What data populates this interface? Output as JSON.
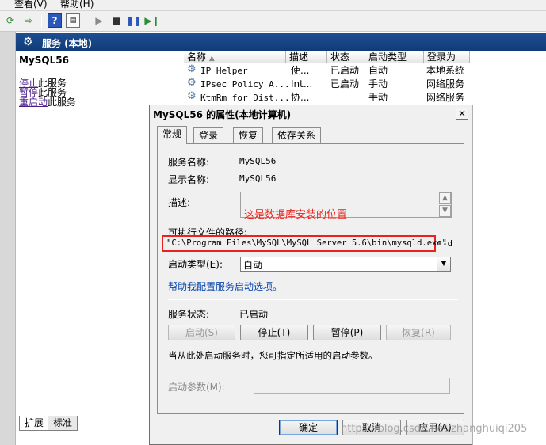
{
  "menubar": {
    "items": [
      "查看(V)",
      "帮助(H)"
    ]
  },
  "toolbar": {
    "icons": [
      "refresh-icon",
      "export-icon",
      "help-icon",
      "properties-icon",
      "play-icon",
      "stop-icon",
      "pause-icon",
      "restart-icon"
    ]
  },
  "pane": {
    "title": "服务 (本地)"
  },
  "left_panel": {
    "service_name": "MySQL56",
    "actions": [
      {
        "link": "停止",
        "rest": "此服务"
      },
      {
        "link": "暂停",
        "rest": "此服务"
      },
      {
        "link": "重启动",
        "rest": "此服务"
      }
    ]
  },
  "list": {
    "columns": [
      "名称",
      "描述",
      "状态",
      "启动类型",
      "登录为"
    ],
    "rows": [
      {
        "name": "IP Helper",
        "desc": "使...",
        "status": "已启动",
        "startup": "自动",
        "logon": "本地系统"
      },
      {
        "name": "IPsec Policy A...",
        "desc": "Int...",
        "status": "已启动",
        "startup": "手动",
        "logon": "网络服务"
      },
      {
        "name": "KtmRm for Dist...",
        "desc": "协...",
        "status": "",
        "startup": "手动",
        "logon": "网络服务"
      }
    ]
  },
  "bottom_tabs": {
    "extended": "扩展",
    "standard": "标准"
  },
  "dialog": {
    "title": "MySQL56 的属性(本地计算机)",
    "close": "×",
    "tabs": [
      "常规",
      "登录",
      "恢复",
      "依存关系"
    ],
    "service_name_label": "服务名称:",
    "service_name_value": "MySQL56",
    "display_name_label": "显示名称:",
    "display_name_value": "MySQL56",
    "description_label": "描述:",
    "annotation": "这是数据库安装的位置",
    "path_label": "可执行文件的路径:",
    "path_value": "\"C:\\Program Files\\MySQL\\MySQL Server 5.6\\bin\\mysqld.exe\"",
    "path_overflow": " --d",
    "startup_type_label": "启动类型(E):",
    "startup_type_value": "自动",
    "help_link": "帮助我配置服务启动选项。",
    "status_label": "服务状态:",
    "status_value": "已启动",
    "buttons": {
      "start": "启动(S)",
      "stop": "停止(T)",
      "pause": "暂停(P)",
      "resume": "恢复(R)"
    },
    "hint": "当从此处启动服务时，您可指定所适用的启动参数。",
    "params_label": "启动参数(M):",
    "ok": "确定",
    "cancel": "取消",
    "apply": "应用(A)"
  },
  "watermark": "https://blog.csdn.net/zhanghuiqi205"
}
